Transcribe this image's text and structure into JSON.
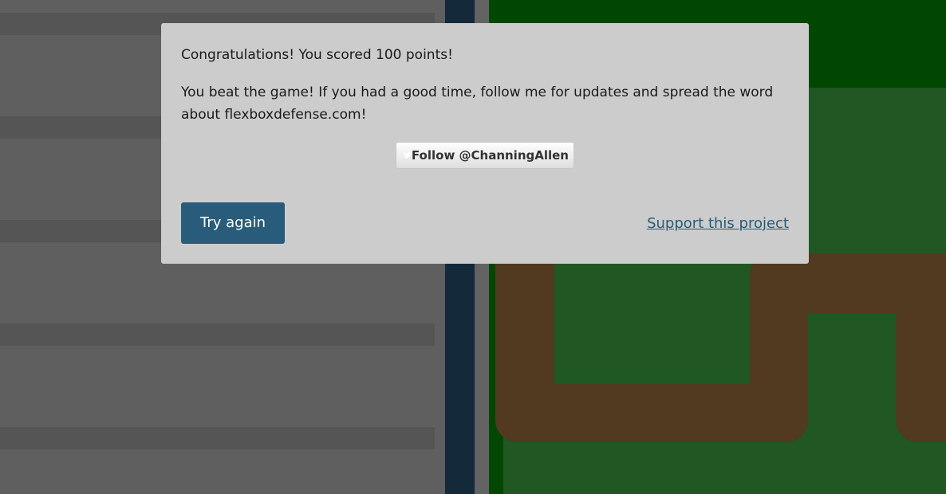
{
  "modal": {
    "score_message": "Congratulations! You scored 100 points!",
    "beat_message": "You beat the game! If you had a good time, follow me for updates and spread the word about flexboxdefense.com!",
    "follow_button_label": "Follow @ChanningAllen",
    "follow_icon": "bird-icon",
    "try_again_label": "Try again",
    "support_link_label": "Support this project"
  },
  "colors": {
    "overlay_gray": "#5f5f5f",
    "modal_background": "#cccccc",
    "accent_blue": "#285c7a",
    "grass": "#215723",
    "grass_dark": "#014702",
    "path_dirt": "#513a1f",
    "divider": "#142a3a"
  }
}
